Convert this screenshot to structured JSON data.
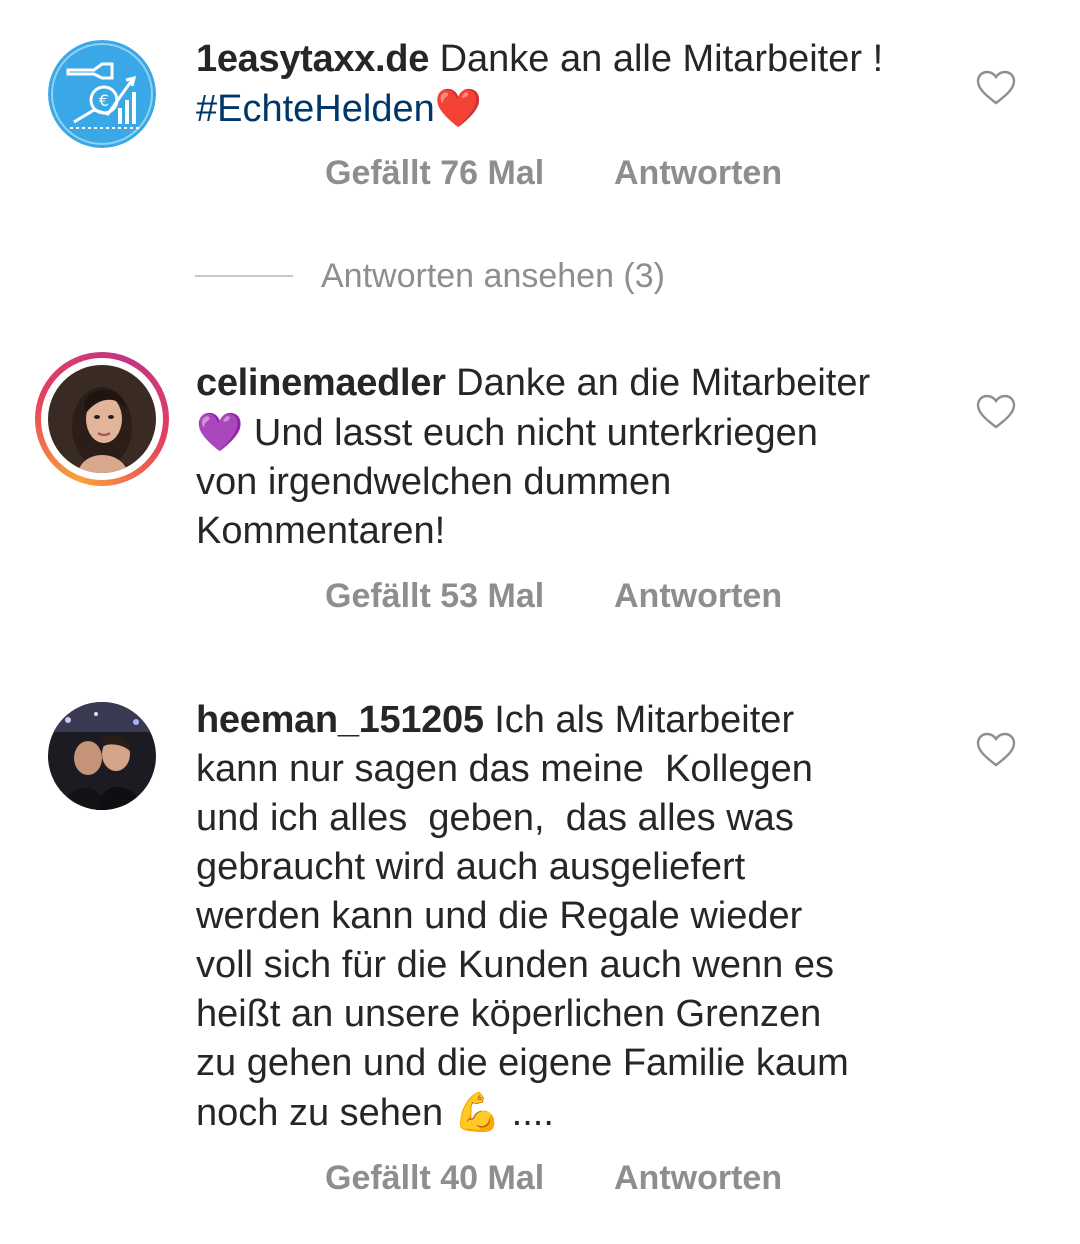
{
  "comments": [
    {
      "username": "1easytaxx.de",
      "text_line1": "Danke an alle Mitarbeiter !",
      "hashtag": "#EchteHelden",
      "heart_emoji": "❤️",
      "likes_label": "Gefällt 76 Mal",
      "reply_label": "Antworten",
      "avatar_icon": "tax-euro-growth-icon",
      "avatar_color": "#3aa7e6"
    },
    {
      "username": "celinemaedler",
      "text_line1": "Danke an die Mitarbeiter",
      "emoji": "💜",
      "text_rest": "Und lasst euch nicht unterkriegen",
      "text_line3": "von irgendwelchen dummen",
      "text_line4": "Kommentaren!",
      "likes_label": "Gefällt 53 Mal",
      "reply_label": "Antworten"
    },
    {
      "username": "heeman_151205",
      "text_line1": "Ich als Mitarbeiter",
      "text_line2": "kann nur sagen das meine  Kollegen",
      "text_line3": "und ich alles  geben,  das alles was",
      "text_line4": "gebraucht wird auch ausgeliefert",
      "text_line5": "werden kann und die Regale wieder",
      "text_line6": "voll sich für die Kunden auch wenn es",
      "text_line7": "heißt an unsere köperlichen Grenzen",
      "text_line8": "zu gehen und die eigene Familie kaum",
      "text_line9": "noch zu sehen",
      "emoji": "💪",
      "ellipsis": "....",
      "likes_label": "Gefällt 40 Mal",
      "reply_label": "Antworten"
    }
  ],
  "view_replies_label": "Antworten ansehen (3)",
  "colors": {
    "text": "#262626",
    "secondary": "#8e8e8e",
    "hashtag": "#00376b",
    "divider": "#c7c7c7"
  }
}
